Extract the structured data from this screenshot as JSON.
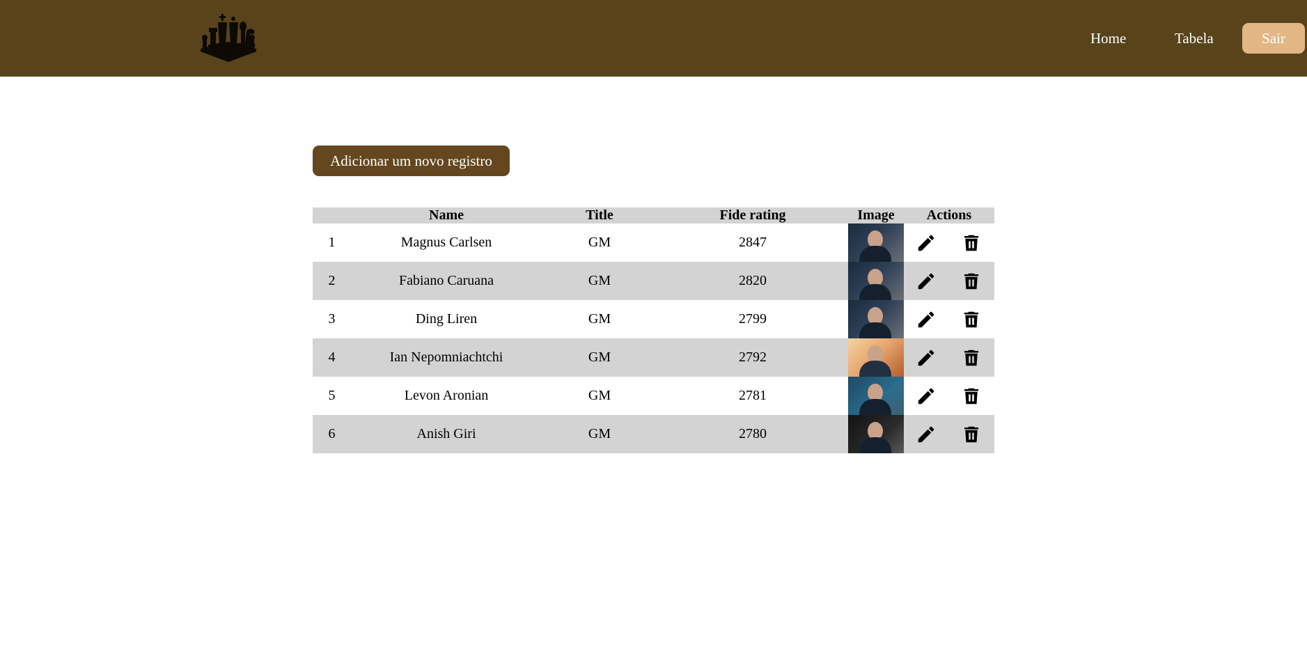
{
  "header": {
    "logo_icon": "chess-pieces-icon",
    "nav": {
      "home": "Home",
      "tabela": "Tabela",
      "sair": "Sair"
    }
  },
  "main": {
    "add_button": "Adicionar um novo registro",
    "table": {
      "columns": [
        "",
        "Name",
        "Title",
        "Fide rating",
        "Image",
        "Actions"
      ],
      "rows": [
        {
          "idx": "1",
          "name": "Magnus Carlsen",
          "title": "GM",
          "rating": "2847"
        },
        {
          "idx": "2",
          "name": "Fabiano Caruana",
          "title": "GM",
          "rating": "2820"
        },
        {
          "idx": "3",
          "name": "Ding Liren",
          "title": "GM",
          "rating": "2799"
        },
        {
          "idx": "4",
          "name": "Ian Nepomniachtchi",
          "title": "GM",
          "rating": "2792"
        },
        {
          "idx": "5",
          "name": "Levon Aronian",
          "title": "GM",
          "rating": "2781"
        },
        {
          "idx": "6",
          "name": "Anish Giri",
          "title": "GM",
          "rating": "2780"
        }
      ],
      "actions": {
        "edit_icon": "pencil-icon",
        "delete_icon": "trash-icon"
      }
    }
  },
  "colors": {
    "header_bg": "#58431b",
    "add_button_bg": "#64471f",
    "sair_button_bg": "#e2b785",
    "stripe_bg": "#d3d3d3"
  }
}
